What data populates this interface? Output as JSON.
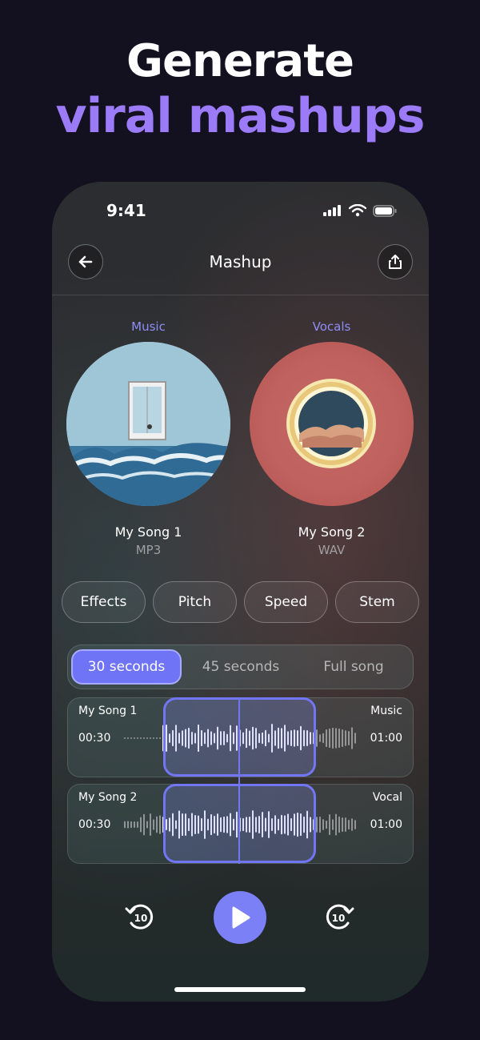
{
  "headline": {
    "line1": "Generate",
    "line2": "viral mashups"
  },
  "status_bar": {
    "time": "9:41"
  },
  "nav": {
    "title": "Mashup"
  },
  "tracks": [
    {
      "kind": "Music",
      "name": "My Song 1",
      "format": "MP3",
      "art": "window-over-waves"
    },
    {
      "kind": "Vocals",
      "name": "My Song 2",
      "format": "WAV",
      "art": "glowing-ring-clouds"
    }
  ],
  "chips": [
    "Effects",
    "Pitch",
    "Speed",
    "Stem"
  ],
  "duration_options": {
    "options": [
      "30 seconds",
      "45 seconds",
      "Full song"
    ],
    "selected": "30 seconds"
  },
  "lanes": [
    {
      "name": "My Song 1",
      "kind": "Music",
      "start": "00:30",
      "end": "01:00"
    },
    {
      "name": "My Song 2",
      "kind": "Vocal",
      "start": "00:30",
      "end": "01:00"
    }
  ],
  "controls": {
    "skip_back": "10",
    "skip_forward": "10"
  },
  "colors": {
    "accent": "#7b80f7",
    "headline_accent": "#9b7bf7",
    "background": "#13111f"
  }
}
